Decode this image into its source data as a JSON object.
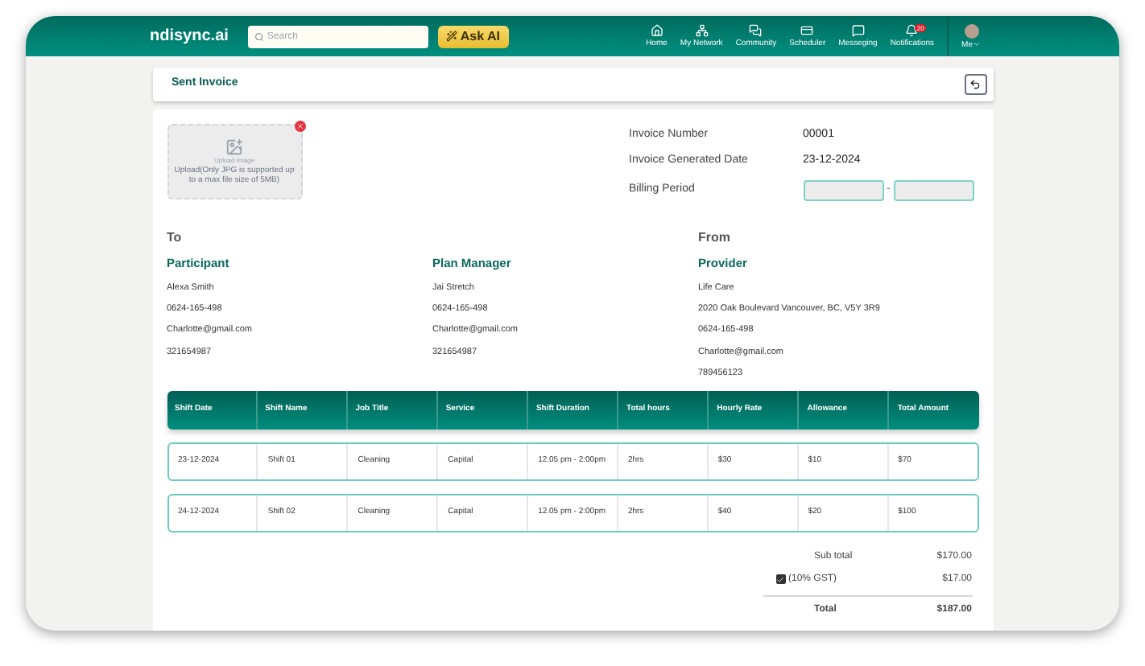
{
  "header": {
    "logo": "ndisync.ai",
    "search": {
      "placeholder": "Search"
    },
    "ask_ai": "Ask AI",
    "nav": [
      {
        "label": "Home",
        "kind": "home"
      },
      {
        "label": "My Network",
        "kind": "network"
      },
      {
        "label": "Community",
        "kind": "community"
      },
      {
        "label": "Scheduler",
        "kind": "scheduler"
      },
      {
        "label": "Messeging",
        "kind": "message"
      },
      {
        "label": "Notifications",
        "kind": "bell",
        "badge": "20"
      }
    ],
    "profile": "Me"
  },
  "page_title": "Sent Invoice",
  "upload": {
    "title": "Upload Image",
    "hint": "Upload(Only JPG is supported up to a max file size of 5MB)"
  },
  "invoice_meta": [
    {
      "label": "Invoice Number",
      "value": "00001"
    },
    {
      "label": "Invoice Generated Date",
      "value": "23-12-2024"
    }
  ],
  "billing_period": {
    "label": "Billing Period",
    "separator": "-"
  },
  "to_heading": "To",
  "from_heading": "From",
  "parties": [
    {
      "role": "Participant",
      "lines": [
        "Alexa Smith",
        "0624-165-498",
        "Charlotte@gmail.com",
        "321654987"
      ]
    },
    {
      "role": "Plan Manager",
      "lines": [
        "Jai Stretch",
        "0624-165-498",
        "Charlotte@gmail.com",
        "321654987"
      ]
    },
    {
      "role": "Provider",
      "lines": [
        "Life Care",
        "2020 Oak Boulevard Vancouver, BC, V5Y 3R9",
        "0624-165-498",
        "Charlotte@gmail.com",
        "789456123"
      ]
    }
  ],
  "table": {
    "columns": [
      "Shift Date",
      "Shift Name",
      "Job Title",
      "Service",
      "Shift Duration",
      "Total hours",
      "Hourly Rate",
      "Allowance",
      "Total Amount"
    ],
    "rows": [
      [
        "23-12-2024",
        "Shift 01",
        "Cleaning",
        "Capital",
        "12.05 pm - 2:00pm",
        "2hrs",
        "$30",
        "$10",
        "$70"
      ],
      [
        "24-12-2024",
        "Shift 02",
        "Cleaning",
        "Capital",
        "12.05 pm - 2:00pm",
        "2hrs",
        "$40",
        "$20",
        "$100"
      ]
    ]
  },
  "totals": {
    "subtotal": {
      "label": "Sub total",
      "value": "$170.00"
    },
    "gst": {
      "label": "(10% GST)",
      "value": "$17.00",
      "checked": true
    },
    "total": {
      "label": "Total",
      "value": "$187.00"
    }
  }
}
